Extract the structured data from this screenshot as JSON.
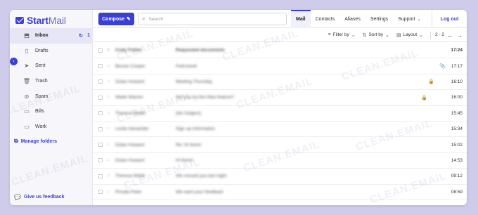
{
  "brand": {
    "name_bold": "Start",
    "name_light": "Mail"
  },
  "sidebar": {
    "items": [
      {
        "label": "Inbox",
        "icon": "inbox-icon",
        "glyph": "⬒",
        "count": "1",
        "active": true
      },
      {
        "label": "Drafts",
        "icon": "drafts-icon",
        "glyph": "▯"
      },
      {
        "label": "Sent",
        "icon": "sent-icon",
        "glyph": "➤"
      },
      {
        "label": "Trash",
        "icon": "trash-icon",
        "glyph": "🗑"
      },
      {
        "label": "Spam",
        "icon": "spam-icon",
        "glyph": "⊘"
      },
      {
        "label": "Bills",
        "icon": "folder-icon",
        "glyph": "▭"
      },
      {
        "label": "Work",
        "icon": "folder-icon",
        "glyph": "▭"
      }
    ],
    "manage_folders": "Manage folders",
    "feedback": "Give us feedback"
  },
  "topbar": {
    "compose": "Compose",
    "search_placeholder": "Search",
    "tabs": [
      "Mail",
      "Contacts",
      "Aliases",
      "Settings",
      "Support"
    ],
    "logout": "Log out"
  },
  "toolbar": {
    "filter": "Filter by",
    "sort": "Sort by",
    "layout": "Layout",
    "page": "2 - 2"
  },
  "messages": [
    {
      "sender": "Cody Fisher",
      "subject": "Requested documents",
      "time": "17:24",
      "unread": true,
      "icon": ""
    },
    {
      "sender": "Bessie Cooper",
      "subject": "Fwd:travel",
      "time": "17:17",
      "unread": false,
      "icon": "attachment-icon"
    },
    {
      "sender": "Dolan Howard",
      "subject": "Meeting Thursday",
      "time": "16:10",
      "unread": false,
      "icon": "lock-icon"
    },
    {
      "sender": "Wade Warren",
      "subject": "Did you try the Alias feature?",
      "time": "16:00",
      "unread": false,
      "icon": "lock-icon"
    },
    {
      "sender": "Theresa Webb",
      "subject": "(No Subject)",
      "time": "15:45",
      "unread": false,
      "icon": ""
    },
    {
      "sender": "Leslie Alexander",
      "subject": "Sign up information",
      "time": "15:34",
      "unread": false,
      "icon": ""
    },
    {
      "sender": "Dolan Howard",
      "subject": "Re: Hi there!",
      "time": "15:02",
      "unread": false,
      "icon": ""
    },
    {
      "sender": "Dolan Howard",
      "subject": "Hi there!",
      "time": "14:53",
      "unread": false,
      "icon": ""
    },
    {
      "sender": "Theresa Webb",
      "subject": "We missed you last night",
      "time": "09:12",
      "unread": false,
      "icon": ""
    },
    {
      "sender": "Private Peter",
      "subject": "We want your feedback",
      "time": "08:59",
      "unread": false,
      "icon": ""
    }
  ],
  "watermark": "CLEAN.EMAIL",
  "colors": {
    "accent": "#3a3fd6",
    "background": "#cfcbea"
  }
}
